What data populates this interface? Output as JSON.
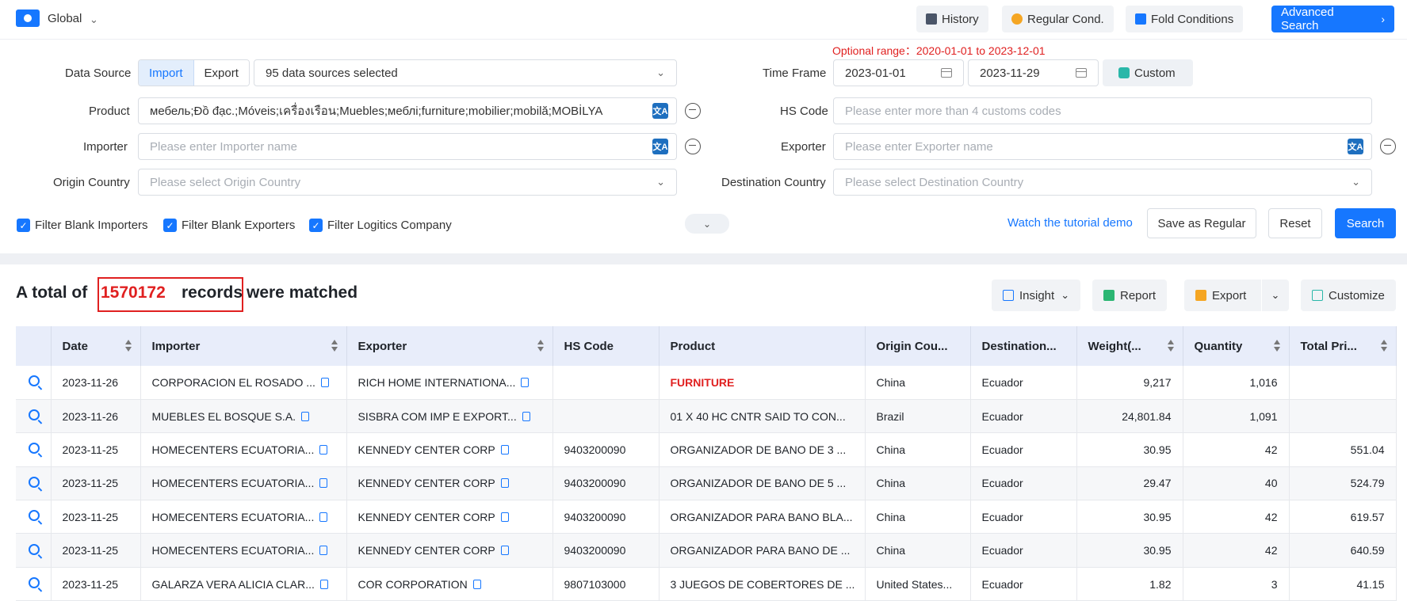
{
  "header": {
    "region": "Global",
    "history": "History",
    "regular_cond": "Regular Cond.",
    "fold_conditions": "Fold Conditions",
    "advanced_search": "Advanced Search"
  },
  "filters": {
    "data_source_label": "Data Source",
    "import_label": "Import",
    "export_label": "Export",
    "data_sources_value": "95 data sources selected",
    "time_frame_label": "Time Frame",
    "optional_range": "Optional range：2020-01-01 to 2023-12-01",
    "date_start": "2023-01-01",
    "date_end": "2023-11-29",
    "custom_label": "Custom",
    "product_label": "Product",
    "product_value": "мебель;Đồ đạc.;Móveis;เครื่องเรือน;Muebles;меблі;furniture;mobilier;mobilă;MOBİLYA",
    "hs_code_label": "HS Code",
    "hs_code_placeholder": "Please enter more than 4 customs codes",
    "importer_label": "Importer",
    "importer_placeholder": "Please enter Importer name",
    "exporter_label": "Exporter",
    "exporter_placeholder": "Please enter Exporter name",
    "origin_country_label": "Origin Country",
    "origin_country_placeholder": "Please select Origin Country",
    "destination_country_label": "Destination Country",
    "destination_country_placeholder": "Please select Destination Country",
    "filter_blank_importers": "Filter Blank Importers",
    "filter_blank_exporters": "Filter Blank Exporters",
    "filter_logistics": "Filter Logitics Company",
    "tutorial_link": "Watch the tutorial demo",
    "save_regular": "Save as Regular",
    "reset": "Reset",
    "search": "Search"
  },
  "results": {
    "prefix": "A total of",
    "count": "1570172",
    "records": "records",
    "suffix": "were matched",
    "insight": "Insight",
    "report": "Report",
    "export": "Export",
    "customize": "Customize"
  },
  "table": {
    "columns": [
      "Date",
      "Importer",
      "Exporter",
      "HS Code",
      "Product",
      "Origin Cou...",
      "Destination...",
      "Weight(...",
      "Quantity",
      "Total Pri..."
    ],
    "rows": [
      {
        "date": "2023-11-26",
        "importer": "CORPORACION EL ROSADO ...",
        "exporter": "RICH HOME INTERNATIONA...",
        "hs": "",
        "product": "FURNITURE",
        "origin": "China",
        "dest": "Ecuador",
        "weight": "9,217",
        "qty": "1,016",
        "total": ""
      },
      {
        "date": "2023-11-26",
        "importer": "MUEBLES EL BOSQUE S.A.",
        "exporter": "SISBRA COM IMP E EXPORT...",
        "hs": "",
        "product": "01 X 40 HC CNTR SAID TO CON...",
        "origin": "Brazil",
        "dest": "Ecuador",
        "weight": "24,801.84",
        "qty": "1,091",
        "total": ""
      },
      {
        "date": "2023-11-25",
        "importer": "HOMECENTERS ECUATORIA...",
        "exporter": "KENNEDY CENTER CORP",
        "hs": "9403200090",
        "product": "ORGANIZADOR DE BANO DE 3 ...",
        "origin": "China",
        "dest": "Ecuador",
        "weight": "30.95",
        "qty": "42",
        "total": "551.04"
      },
      {
        "date": "2023-11-25",
        "importer": "HOMECENTERS ECUATORIA...",
        "exporter": "KENNEDY CENTER CORP",
        "hs": "9403200090",
        "product": "ORGANIZADOR DE BANO DE 5 ...",
        "origin": "China",
        "dest": "Ecuador",
        "weight": "29.47",
        "qty": "40",
        "total": "524.79"
      },
      {
        "date": "2023-11-25",
        "importer": "HOMECENTERS ECUATORIA...",
        "exporter": "KENNEDY CENTER CORP",
        "hs": "9403200090",
        "product": "ORGANIZADOR PARA BANO BLA...",
        "origin": "China",
        "dest": "Ecuador",
        "weight": "30.95",
        "qty": "42",
        "total": "619.57"
      },
      {
        "date": "2023-11-25",
        "importer": "HOMECENTERS ECUATORIA...",
        "exporter": "KENNEDY CENTER CORP",
        "hs": "9403200090",
        "product": "ORGANIZADOR PARA BANO DE ...",
        "origin": "China",
        "dest": "Ecuador",
        "weight": "30.95",
        "qty": "42",
        "total": "640.59"
      },
      {
        "date": "2023-11-25",
        "importer": "GALARZA VERA ALICIA CLAR...",
        "exporter": "COR CORPORATION",
        "hs": "9807103000",
        "product": "3 JUEGOS DE COBERTORES DE ...",
        "origin": "United States...",
        "dest": "Ecuador",
        "weight": "1.82",
        "qty": "3",
        "total": "41.15"
      }
    ]
  },
  "colors": {
    "accent": "#1677ff",
    "highlight": "#e02020",
    "header_bg": "#e8edfa"
  }
}
